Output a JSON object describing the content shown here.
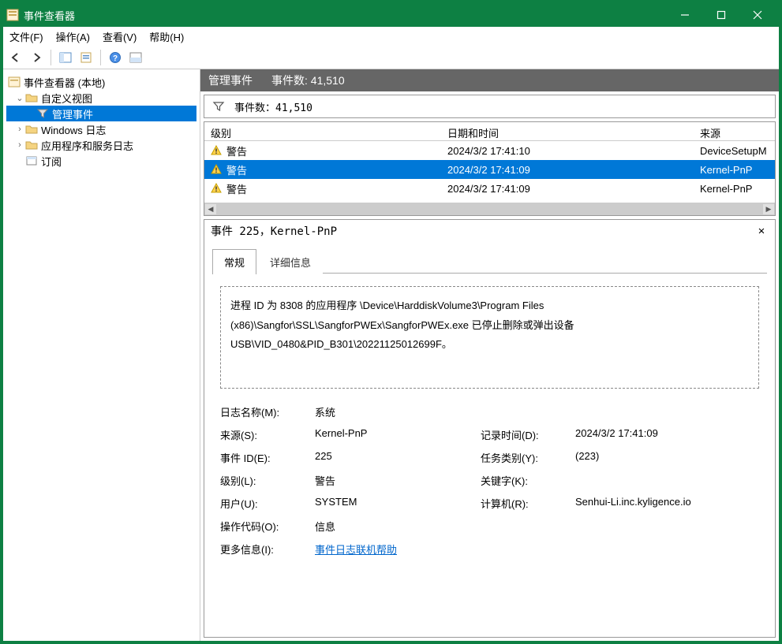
{
  "window": {
    "title": "事件查看器"
  },
  "menu": {
    "file": "文件(F)",
    "action": "操作(A)",
    "view": "查看(V)",
    "help": "帮助(H)"
  },
  "tree": {
    "root": "事件查看器 (本地)",
    "custom_views": "自定义视图",
    "admin_events": "管理事件",
    "windows_logs": "Windows 日志",
    "app_service_logs": "应用程序和服务日志",
    "subscriptions": "订阅"
  },
  "content": {
    "header_title": "管理事件",
    "header_count_label": "事件数: 41,510",
    "filter_label": "事件数：41,510"
  },
  "columns": {
    "level": "级别",
    "datetime": "日期和时间",
    "source": "来源"
  },
  "events": [
    {
      "level": "警告",
      "datetime": "2024/3/2 17:41:10",
      "source": "DeviceSetupM"
    },
    {
      "level": "警告",
      "datetime": "2024/3/2 17:41:09",
      "source": "Kernel-PnP"
    },
    {
      "level": "警告",
      "datetime": "2024/3/2 17:41:09",
      "source": "Kernel-PnP"
    }
  ],
  "detail": {
    "title": "事件 225，Kernel-PnP",
    "tab_general": "常规",
    "tab_details": "详细信息",
    "description": "进程 ID 为 8308 的应用程序 \\Device\\HarddiskVolume3\\Program Files (x86)\\Sangfor\\SSL\\SangforPWEx\\SangforPWEx.exe 已停止删除或弹出设备 USB\\VID_0480&PID_B301\\20221125012699F。",
    "labels": {
      "log_name": "日志名称(M):",
      "source": "来源(S):",
      "event_id": "事件 ID(E):",
      "level": "级别(L):",
      "user": "用户(U):",
      "opcode": "操作代码(O):",
      "more_info": "更多信息(I):",
      "logged": "记录时间(D):",
      "task_category": "任务类别(Y):",
      "keywords": "关键字(K):",
      "computer": "计算机(R):"
    },
    "values": {
      "log_name": "系统",
      "source": "Kernel-PnP",
      "event_id": "225",
      "level": "警告",
      "user": "SYSTEM",
      "opcode": "信息",
      "more_info": "事件日志联机帮助",
      "logged": "2024/3/2 17:41:09",
      "task_category": "(223)",
      "keywords": "",
      "computer": "Senhui-Li.inc.kyligence.io"
    }
  }
}
